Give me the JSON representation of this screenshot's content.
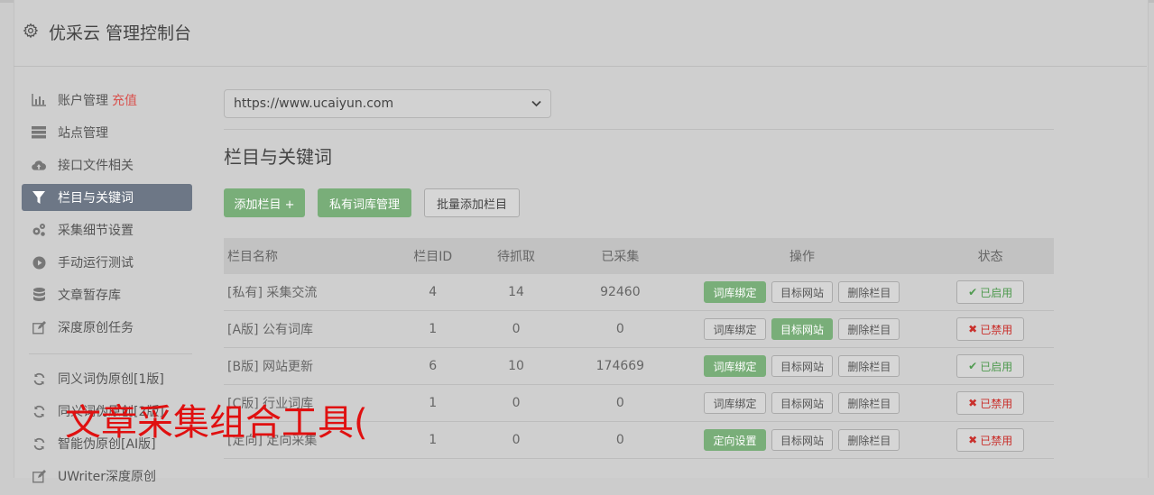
{
  "header": {
    "title": "优采云 管理控制台",
    "icon": "gear-icon"
  },
  "sidebar": {
    "items": [
      {
        "label": "账户管理",
        "extra": "充值",
        "icon": "bar-chart-icon"
      },
      {
        "label": "站点管理",
        "icon": "server-icon"
      },
      {
        "label": "接口文件相关",
        "icon": "cloud-upload-icon"
      },
      {
        "label": "栏目与关键词",
        "icon": "filter-icon",
        "active": true
      },
      {
        "label": "采集细节设置",
        "icon": "gears-icon"
      },
      {
        "label": "手动运行测试",
        "icon": "play-circle-icon"
      },
      {
        "label": "文章暂存库",
        "icon": "database-icon"
      },
      {
        "label": "深度原创任务",
        "icon": "edit-icon"
      }
    ],
    "tools": [
      {
        "label": "同义词伪原创[1版]",
        "icon": "refresh-icon"
      },
      {
        "label": "同义词伪原创[2版]",
        "icon": "refresh-icon"
      },
      {
        "label": "智能伪原创[AI版]",
        "icon": "refresh-icon"
      },
      {
        "label": "UWriter深度原创",
        "icon": "edit-icon"
      }
    ]
  },
  "site_select": {
    "value": "https://www.ucaiyun.com"
  },
  "section_title": "栏目与关键词",
  "toolbar": {
    "add_column": "添加栏目 +",
    "private_lexicon": "私有词库管理",
    "batch_add": "批量添加栏目"
  },
  "table": {
    "headers": {
      "name": "栏目名称",
      "id": "栏目ID",
      "pending": "待抓取",
      "collected": "已采集",
      "actions": "操作",
      "status": "状态"
    },
    "rows": [
      {
        "tag": "[私有]",
        "name": "采集交流",
        "id": "4",
        "pending": "14",
        "collected": "92460",
        "action1": "词库绑定",
        "action2": "目标网站",
        "action3": "删除栏目",
        "status": "已启用"
      },
      {
        "tag": "[A版]",
        "name": "公有词库",
        "id": "1",
        "pending": "0",
        "collected": "0",
        "action1": "词库绑定",
        "action2": "目标网站",
        "action3": "删除栏目",
        "status": "已禁用"
      },
      {
        "tag": "[B版]",
        "name": "网站更新",
        "id": "6",
        "pending": "10",
        "collected": "174669",
        "action1": "词库绑定",
        "action2": "目标网站",
        "action3": "删除栏目",
        "status": "已启用"
      },
      {
        "tag": "[C版]",
        "name": "行业词库",
        "id": "1",
        "pending": "0",
        "collected": "0",
        "action1": "词库绑定",
        "action2": "目标网站",
        "action3": "删除栏目",
        "status": "已禁用"
      },
      {
        "tag": "[定向]",
        "name": "定向采集",
        "id": "1",
        "pending": "0",
        "collected": "0",
        "action1": "定向设置",
        "action2": "目标网站",
        "action3": "删除栏目",
        "status": "已禁用"
      }
    ]
  },
  "overlay": {
    "text": "文章采集组合工具("
  },
  "colors": {
    "accent_green": "#79ae79",
    "active_nav": "#6d7786",
    "danger": "#c9302c",
    "overlay_red": "#e01010"
  }
}
